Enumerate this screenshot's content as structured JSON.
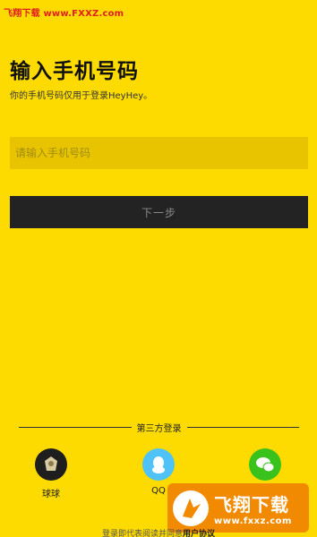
{
  "watermark_top": "飞翔下载 www.FXXZ.com",
  "header": {
    "title": "输入手机号码",
    "subtitle": "你的手机号码仅用于登录HeyHey。"
  },
  "form": {
    "phone_placeholder": "请输入手机号码",
    "phone_value": "",
    "next_label": "下一步"
  },
  "third_party": {
    "label": "第三方登录",
    "items": [
      {
        "name": "球球",
        "icon": "qiuqiu-icon",
        "color": "#1E1E1E"
      },
      {
        "name": "QQ",
        "icon": "qq-penguin-icon",
        "color": "#4FC3F7"
      },
      {
        "name": "微信",
        "icon": "wechat-icon",
        "color": "#39C21B"
      }
    ]
  },
  "agreement": {
    "prefix": "登录即代表阅读并同意",
    "link": "用户协议"
  },
  "watermark_logo": {
    "big": "飞翔下载",
    "small": "www.fxxz.com"
  },
  "colors": {
    "background": "#FDDB00",
    "button": "#232323"
  }
}
